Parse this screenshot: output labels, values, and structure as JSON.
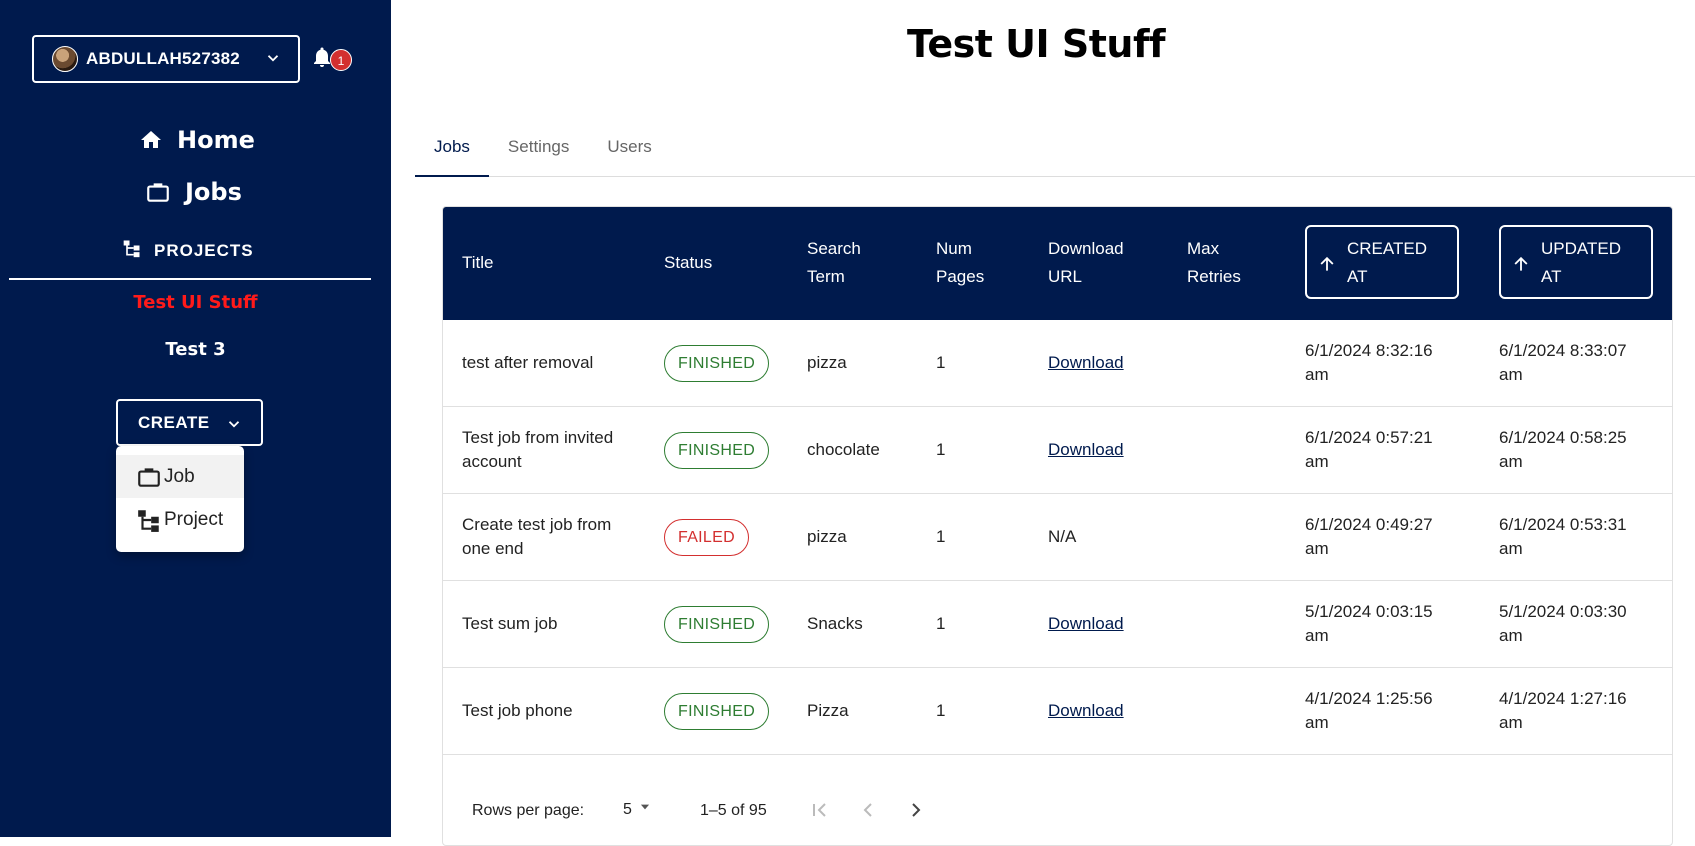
{
  "user": {
    "name": "ABDULLAH527382",
    "notifications": "1"
  },
  "nav": {
    "home": "Home",
    "jobs": "Jobs",
    "projects_header": "PROJECTS"
  },
  "projects": [
    {
      "name": "Test UI Stuff",
      "active": true
    },
    {
      "name": "Test 3",
      "active": false
    }
  ],
  "create": {
    "label": "CREATE",
    "menu": [
      {
        "label": "Job",
        "icon": "briefcase-icon"
      },
      {
        "label": "Project",
        "icon": "project-tree-icon"
      }
    ]
  },
  "page": {
    "title": "Test UI Stuff"
  },
  "tabs": [
    {
      "label": "Jobs",
      "active": true
    },
    {
      "label": "Settings",
      "active": false
    },
    {
      "label": "Users",
      "active": false
    }
  ],
  "table": {
    "headers": {
      "title": "Title",
      "status": "Status",
      "search_term": [
        "Search",
        "Term"
      ],
      "num_pages": [
        "Num",
        "Pages"
      ],
      "download_url": [
        "Download",
        "URL"
      ],
      "max_retries": [
        "Max",
        "Retries"
      ],
      "created_at": [
        "CREATED",
        "AT"
      ],
      "updated_at": [
        "UPDATED",
        "AT"
      ]
    },
    "rows": [
      {
        "title": [
          "test after removal"
        ],
        "status": "FINISHED",
        "search": "pizza",
        "pages": "1",
        "download": "Download",
        "created": [
          "6/1/2024 8:32:16",
          "am"
        ],
        "updated": [
          "6/1/2024 8:33:07",
          "am"
        ]
      },
      {
        "title": [
          "Test job from invited",
          "account"
        ],
        "status": "FINISHED",
        "search": "chocolate",
        "pages": "1",
        "download": "Download",
        "created": [
          "6/1/2024 0:57:21",
          "am"
        ],
        "updated": [
          "6/1/2024 0:58:25",
          "am"
        ]
      },
      {
        "title": [
          "Create test job from",
          "one end"
        ],
        "status": "FAILED",
        "search": "pizza",
        "pages": "1",
        "download": "N/A",
        "created": [
          "6/1/2024 0:49:27",
          "am"
        ],
        "updated": [
          "6/1/2024 0:53:31",
          "am"
        ]
      },
      {
        "title": [
          "Test sum job"
        ],
        "status": "FINISHED",
        "search": "Snacks",
        "pages": "1",
        "download": "Download",
        "created": [
          "5/1/2024 0:03:15",
          "am"
        ],
        "updated": [
          "5/1/2024 0:03:30",
          "am"
        ]
      },
      {
        "title": [
          "Test job phone"
        ],
        "status": "FINISHED",
        "search": "Pizza",
        "pages": "1",
        "download": "Download",
        "created": [
          "4/1/2024 1:25:56",
          "am"
        ],
        "updated": [
          "4/1/2024 1:27:16",
          "am"
        ]
      }
    ]
  },
  "pagination": {
    "rows_label": "Rows per page:",
    "rows_value": "5",
    "range": "1–5 of 95"
  },
  "colors": {
    "navy": "#001a4d",
    "active_project": "#ff1a1a",
    "finished": "#2e7d32",
    "failed": "#d32f2f"
  }
}
